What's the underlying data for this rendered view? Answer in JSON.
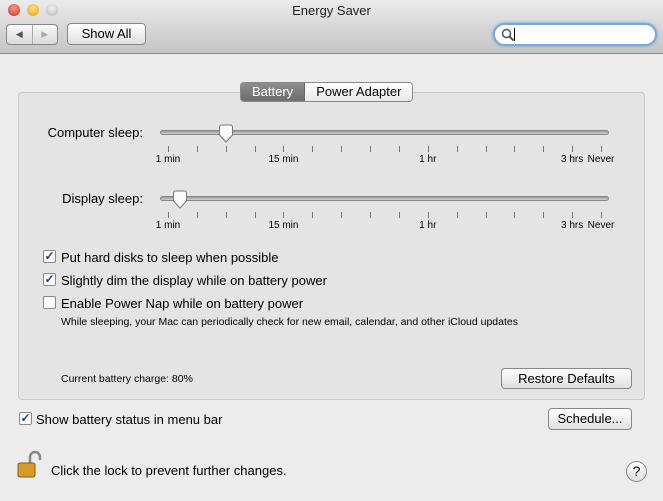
{
  "window": {
    "title": "Energy Saver"
  },
  "toolbar": {
    "back": "◀",
    "forward": "▶",
    "show_all": "Show All",
    "search_placeholder": "",
    "search_value": ""
  },
  "tabs": [
    {
      "label": "Battery",
      "selected": true
    },
    {
      "label": "Power Adapter",
      "selected": false
    }
  ],
  "sliders": [
    {
      "label": "Computer sleep:",
      "tick_index": 2
    },
    {
      "label": "Display sleep:",
      "tick_index": 0.4
    }
  ],
  "tick_count": 16,
  "tick_labels": [
    {
      "text": "1 min",
      "tick": 0
    },
    {
      "text": "15 min",
      "tick": 4
    },
    {
      "text": "1 hr",
      "tick": 9
    },
    {
      "text": "3 hrs",
      "tick": 14
    },
    {
      "text": "Never",
      "tick": 15
    }
  ],
  "options": [
    {
      "label": "Put hard disks to sleep when possible",
      "checked": true
    },
    {
      "label": "Slightly dim the display while on battery power",
      "checked": true
    },
    {
      "label": "Enable Power Nap while on battery power",
      "checked": false
    }
  ],
  "power_nap_desc": "While sleeping, your Mac can periodically check for new email, calendar, and other iCloud updates",
  "battery_charge": "Current battery charge: 80%",
  "restore_defaults": "Restore Defaults",
  "show_battery_status": {
    "label": "Show battery status in menu bar",
    "checked": true
  },
  "schedule": "Schedule...",
  "lock_text": "Click the lock to prevent further changes.",
  "help": "?"
}
